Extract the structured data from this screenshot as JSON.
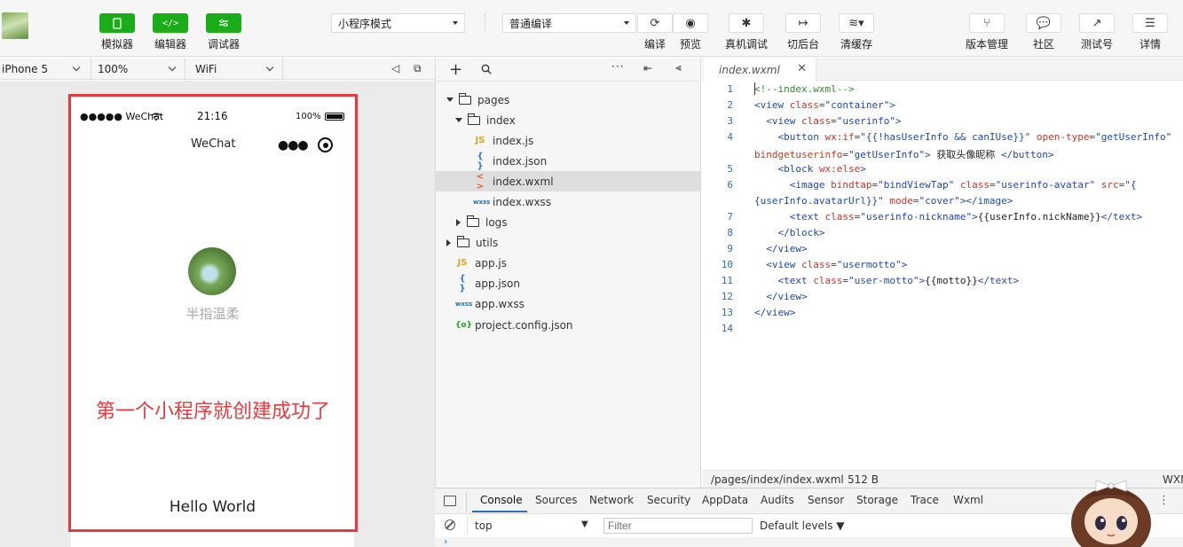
{
  "toolbar": {
    "simulator": "模拟器",
    "editor": "编辑器",
    "debugger": "调试器",
    "mode_select": "小程序模式",
    "compile_select": "普通编译",
    "compile": "编译",
    "preview": "预览",
    "real_debug": "真机调试",
    "background": "切后台",
    "clear_cache": "清缓存",
    "version": "版本管理",
    "community": "社区",
    "test_account": "测试号",
    "details": "详情"
  },
  "devbar": {
    "device": "iPhone 5",
    "zoom": "100%",
    "network": "WiFi"
  },
  "phone": {
    "carrier": "●●●●● WeChat",
    "time": "21:16",
    "battery": "100%",
    "nav_title": "WeChat",
    "nickname": "半指温柔",
    "annotation": "第一个小程序就创建成功了",
    "motto": "Hello World"
  },
  "files": {
    "pages": "pages",
    "index": "index",
    "index_js": "index.js",
    "index_json": "index.json",
    "index_wxml": "index.wxml",
    "index_wxss": "index.wxss",
    "logs": "logs",
    "utils": "utils",
    "app_js": "app.js",
    "app_json": "app.json",
    "app_wxss": "app.wxss",
    "project_config": "project.config.json",
    "icon_js": "JS",
    "icon_json": "{ }",
    "icon_wxml": "< >",
    "icon_wxss": "wxss",
    "icon_config": "{o}"
  },
  "editor": {
    "tab_title": "index.wxml",
    "status_path": "/pages/index/index.wxml",
    "status_size": "512 B",
    "status_lang": "WXML",
    "line_numbers": [
      "1",
      "2",
      "3",
      "4",
      "5",
      "6",
      "7",
      "8",
      "9",
      "10",
      "11",
      "12",
      "13",
      "14"
    ]
  },
  "devtools": {
    "tabs": [
      "Console",
      "Sources",
      "Network",
      "Security",
      "AppData",
      "Audits",
      "Sensor",
      "Storage",
      "Trace",
      "Wxml"
    ],
    "context": "top",
    "filter_placeholder": "Filter",
    "levels": "Default levels ▼"
  },
  "colors": {
    "accent_green": "#1aad19",
    "annotation_red": "#e8393f"
  }
}
